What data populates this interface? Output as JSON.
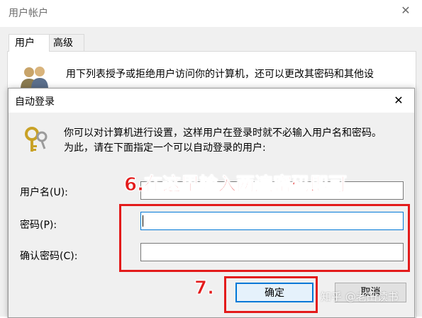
{
  "parent_window": {
    "title": "用户帐户",
    "tabs": [
      {
        "label": "用户"
      },
      {
        "label": "高级"
      }
    ],
    "description": "用下列表授予或拒绝用户访问你的计算机，还可以更改其密码和其他设"
  },
  "dialog": {
    "title": "自动登录",
    "description": "你可以对计算机进行设置，这样用户在登录时就不必输入用户名和密码。\n为此，请在下面指定一个可以自动登录的用户:",
    "fields": {
      "username_label": "用户名(U):",
      "username_value": "",
      "password_label": "密码(P):",
      "password_value": "",
      "confirm_label": "确认密码(C):",
      "confirm_value": ""
    },
    "buttons": {
      "ok": "确定",
      "cancel": "取消"
    }
  },
  "annotations": {
    "step6": "6.在这里输入两遍密码即可",
    "step7": "7."
  },
  "watermark": "知乎 @老田读书",
  "colors": {
    "annotation_red": "#e31b1b",
    "focus_blue": "#0078d7"
  },
  "icons": {
    "users": "users-icon",
    "key": "key-icon",
    "close": "close-icon"
  }
}
